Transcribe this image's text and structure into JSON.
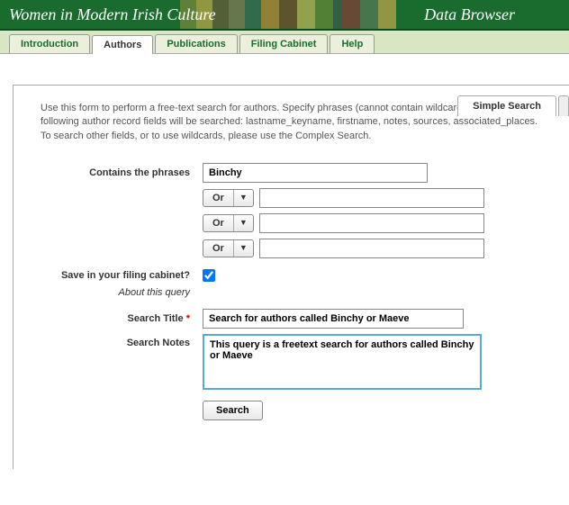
{
  "header": {
    "title": "Women in Modern Irish Culture",
    "subtitle": "Data Browser"
  },
  "tabs": {
    "items": [
      "Introduction",
      "Authors",
      "Publications",
      "Filing Cabinet",
      "Help"
    ]
  },
  "subtabs": {
    "simple": "Simple Search"
  },
  "panel": {
    "intro": "Use this form to perform a free-text search for authors. Specify phrases (cannot contain wildcards), and the following author record fields will be searched: lastname_keyname, firstname, notes, sources, associated_places. To search other fields, or to use wildcards, please use the Complex Search.",
    "contains_label": "Contains the phrases",
    "contains_value": "Binchy",
    "or_label": "Or",
    "save_label": "Save in your filing cabinet?",
    "save_checked": true,
    "about_label": "About this query",
    "title_label": "Search Title",
    "title_value": "Search for authors called Binchy or Maeve",
    "notes_label": "Search Notes",
    "notes_value": "This query is a freetext search for authors called Binchy or Maeve",
    "search_btn": "Search"
  }
}
